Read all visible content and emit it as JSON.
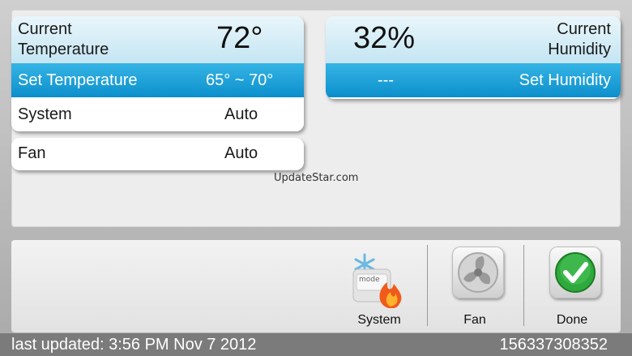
{
  "temperature": {
    "current_label_line1": "Current",
    "current_label_line2": "Temperature",
    "current_value": "72°",
    "set_label": "Set Temperature",
    "set_value": "65° ~ 70°"
  },
  "system": {
    "label": "System",
    "value": "Auto"
  },
  "fan": {
    "label": "Fan",
    "value": "Auto"
  },
  "humidity": {
    "current_value": "32%",
    "current_label_line1": "Current",
    "current_label_line2": "Humidity",
    "set_label": "Set Humidity",
    "set_value": "---"
  },
  "watermark": "UpdateStar.com",
  "toolbar": {
    "system_label": "System",
    "fan_label": "Fan",
    "done_label": "Done",
    "mode_text": "mode"
  },
  "status": {
    "last_updated": "last updated: 3:56 PM Nov 7 2012",
    "device_id": "156337308352"
  },
  "colors": {
    "accent_blue": "#0b8fcc",
    "done_green": "#2eaa3c",
    "flame_orange": "#f05a1a"
  },
  "icons": [
    "mode-icon",
    "fan-icon",
    "checkmark-icon"
  ]
}
